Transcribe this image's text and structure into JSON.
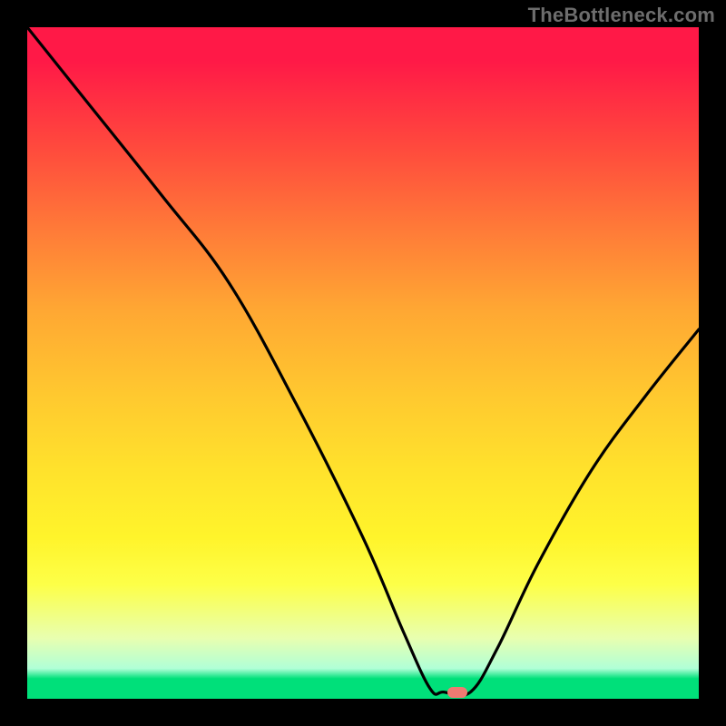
{
  "attribution": "TheBottleneck.com",
  "chart_data": {
    "type": "line",
    "title": "",
    "xlabel": "",
    "ylabel": "",
    "xlim": [
      0,
      100
    ],
    "ylim": [
      0,
      100
    ],
    "grid": false,
    "series": [
      {
        "name": "bottleneck-curve",
        "x": [
          0,
          8,
          20,
          30,
          40,
          50,
          56,
          60,
          62,
          66,
          70,
          76,
          84,
          92,
          100
        ],
        "values": [
          100,
          90,
          75,
          62,
          44,
          24,
          10,
          1.5,
          1,
          1,
          7.5,
          20,
          34,
          45,
          55
        ]
      }
    ],
    "markers": [
      {
        "name": "optimal-point",
        "x": 64,
        "y": 1
      }
    ],
    "colors": {
      "curve": "#000000",
      "marker": "#ef7a72",
      "gradient_top": "#ff1947",
      "gradient_mid": "#ffe22c",
      "gradient_bottom": "#00e07a",
      "frame": "#000000"
    }
  }
}
